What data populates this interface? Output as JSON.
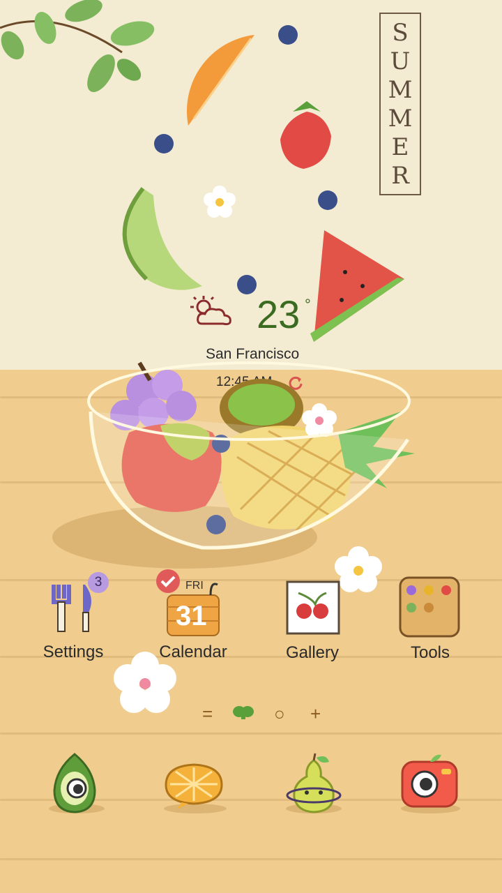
{
  "wallpaper": {
    "summer_letters": [
      "S",
      "U",
      "M",
      "M",
      "E",
      "R"
    ]
  },
  "weather": {
    "temperature": "23",
    "degree": "°",
    "city": "San Francisco",
    "time": "12:45 AM",
    "icon": "partly-cloudy-icon"
  },
  "apps": [
    {
      "label": "Settings",
      "icon": "fork-knife-icon",
      "badge": "3"
    },
    {
      "label": "Calendar",
      "icon": "calendar-basket-icon",
      "day": "FRI",
      "date": "31"
    },
    {
      "label": "Gallery",
      "icon": "cherry-photo-icon"
    },
    {
      "label": "Tools",
      "icon": "tools-box-icon"
    }
  ],
  "page_indicator": {
    "items": [
      "=",
      "",
      "○",
      "+"
    ]
  },
  "dock": [
    {
      "icon": "avocado-phone-icon"
    },
    {
      "icon": "orange-slice-messages-icon"
    },
    {
      "icon": "pear-browser-icon"
    },
    {
      "icon": "apple-camera-icon"
    }
  ],
  "colors": {
    "wall": "#f3ecd3",
    "table": "#f0cd8f",
    "temperature": "#3b6b21",
    "badge": "#b79ae0"
  }
}
